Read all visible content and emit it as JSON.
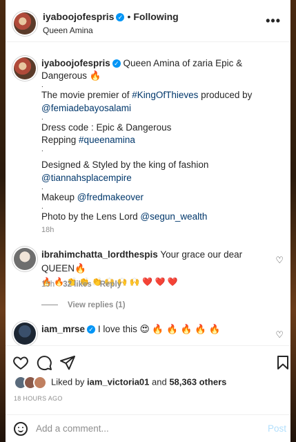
{
  "header": {
    "username": "iyaboojofespris",
    "separator": "•",
    "follow_status": "Following",
    "subtitle": "Queen Amina",
    "more_label": "•••"
  },
  "caption": {
    "username": "iyaboojofespris",
    "lines": [
      {
        "text": "Queen Amina of zaria Epic & Dangerous 🔥"
      },
      {
        "text": "."
      },
      {
        "pre": "The movie premier of ",
        "link": "#KingOfThieves",
        "post": " produced by"
      },
      {
        "pre": "",
        "link": "@femiadebayosalami",
        "post": ""
      },
      {
        "text": "."
      },
      {
        "text": "Dress code : Epic & Dangerous"
      },
      {
        "pre": "Repping ",
        "link": "#queenamina",
        "post": ""
      },
      {
        "text": "."
      },
      {
        "pre": "Designed & Styled by the king of fashion ",
        "link": "@tiannahsplacempire",
        "post": ""
      },
      {
        "text": "."
      },
      {
        "pre": "Makeup ",
        "link": "@fredmakeover",
        "post": ""
      },
      {
        "text": "."
      },
      {
        "pre": "Photo by the Lens Lord ",
        "link": "@segun_wealth",
        "post": ""
      }
    ],
    "time": "18h"
  },
  "comments": [
    {
      "username": "ibrahimchatta_lordthespis",
      "text": "Your grace our dear QUEEN🔥",
      "text2": "🔥 🔥 👏 👏 👏 🙌 🙌 🙌 ❤️ ❤️ ❤️",
      "time": "15h",
      "likes": "32 likes",
      "reply": "Reply",
      "view_replies": "View replies (1)"
    },
    {
      "username": "iam_mrse",
      "text": "I love this 😍 🔥 🔥 🔥 🔥 🔥"
    }
  ],
  "likes": {
    "prefix": "Liked by ",
    "user": "iam_victoria01",
    "middle": " and ",
    "count": "58,363 others"
  },
  "post_time": "18 HOURS AGO",
  "add_comment": {
    "placeholder": "Add a comment...",
    "post_label": "Post"
  },
  "colors": {
    "link": "#00376b",
    "verified": "#0095f6",
    "post_button": "#b2dffc"
  }
}
